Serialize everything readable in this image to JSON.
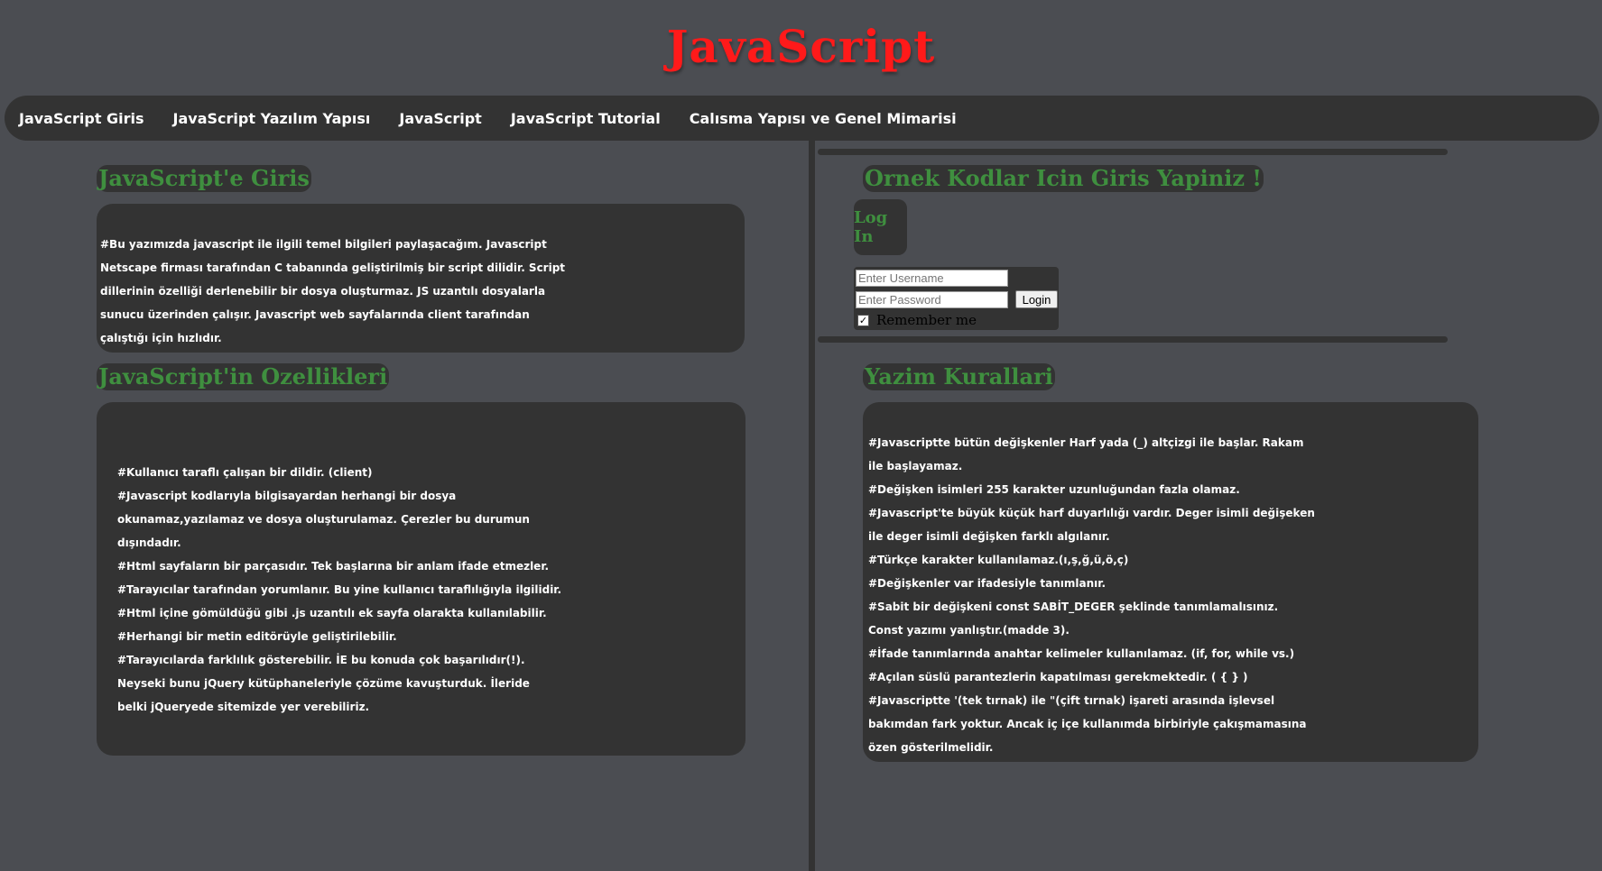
{
  "site": {
    "title": "JavaScript"
  },
  "nav": {
    "items": [
      "JavaScript Giris",
      "JavaScript Yazılım Yapısı",
      "JavaScript",
      "JavaScript Tutorial",
      "Calısma Yapısı ve Genel Mimarisi"
    ]
  },
  "left": {
    "intro": {
      "heading": "JavaScript'e Giris",
      "lines": [
        "#Bu yazımızda javascript ile ilgili temel bilgileri paylaşacağım. Javascript",
        "Netscape firması tarafından C tabanında geliştirilmiş bir script dilidir. Script",
        "dillerinin özelliği derlenebilir bir dosya oluşturmaz. JS uzantılı dosyalarla",
        "sunucu üzerinden çalışır. Javascript web sayfalarında client tarafından",
        "çalıştığı için hızlıdır."
      ]
    },
    "features": {
      "heading": "JavaScript'in Ozellikleri",
      "lines": [
        "#Kullanıcı taraflı çalışan bir dildir. (client)",
        "#Javascript kodlarıyla bilgisayardan herhangi bir dosya",
        "okunamaz,yazılamaz ve dosya oluşturulamaz. Çerezler bu durumun",
        "dışındadır.",
        "#Html sayfaların bir parçasıdır. Tek başlarına bir anlam ifade etmezler.",
        "#Tarayıcılar tarafından yorumlanır. Bu yine kullanıcı taraflılığıyla ilgilidir.",
        "#Html içine gömüldüğü gibi .js uzantılı ek sayfa olarakta kullanılabilir.",
        "#Herhangi bir metin editörüyle geliştirilebilir.",
        "#Tarayıcılarda farklılık gösterebilir. İE bu konuda çok başarılıdır(!).",
        "Neyseki bunu jQuery kütüphaneleriyle çözüme kavuşturduk. İleride",
        "belki jQueryede sitemizde yer verebiliriz."
      ]
    }
  },
  "right": {
    "login": {
      "heading": "Ornek Kodlar Icin Giris Yapiniz !",
      "button_label": "Log In",
      "username_placeholder": "Enter Username",
      "password_placeholder": "Enter Password",
      "submit_label": "Login",
      "remember_label": "Remember me",
      "remember_checked": true
    },
    "rules": {
      "heading": "Yazim Kurallari",
      "lines": [
        "#Javascriptte bütün değişkenler Harf yada (_) altçizgi ile başlar. Rakam",
        "ile başlayamaz.",
        "#Değişken isimleri 255 karakter uzunluğundan fazla olamaz.",
        "#Javascript'te büyük küçük harf duyarlılığı vardır. Deger isimli değişeken",
        "ile deger isimli değişken farklı algılanır.",
        "#Türkçe karakter kullanılamaz.(ı,ş,ğ,ü,ö,ç)",
        "#Değişkenler var ifadesiyle tanımlanır.",
        "#Sabit bir değişkeni const SABİT_DEGER şeklinde tanımlamalısınız.",
        "Const yazımı yanlıştır.(madde 3).",
        "#İfade tanımlarında anahtar kelimeler kullanılamaz. (if, for, while vs.)",
        "#Açılan süslü parantezlerin kapatılması gerekmektedir. ( { } )",
        "#Javascriptte '(tek tırnak) ile \"(çift tırnak) işareti arasında işlevsel",
        "bakımdan fark yoktur. Ancak iç içe kullanımda birbiriyle çakışmamasına",
        "özen gösterilmelidir."
      ]
    }
  }
}
